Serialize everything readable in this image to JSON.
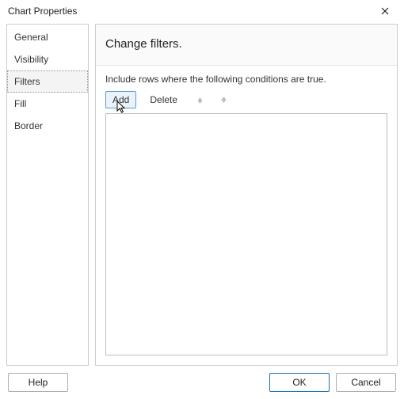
{
  "title": "Chart Properties",
  "sidebar": {
    "items": [
      {
        "label": "General"
      },
      {
        "label": "Visibility"
      },
      {
        "label": "Filters"
      },
      {
        "label": "Fill"
      },
      {
        "label": "Border"
      }
    ],
    "selected_index": 2
  },
  "main": {
    "heading": "Change filters.",
    "hint": "Include rows where the following conditions are true.",
    "toolbar": {
      "add": "Add",
      "delete": "Delete"
    }
  },
  "footer": {
    "help": "Help",
    "ok": "OK",
    "cancel": "Cancel"
  }
}
